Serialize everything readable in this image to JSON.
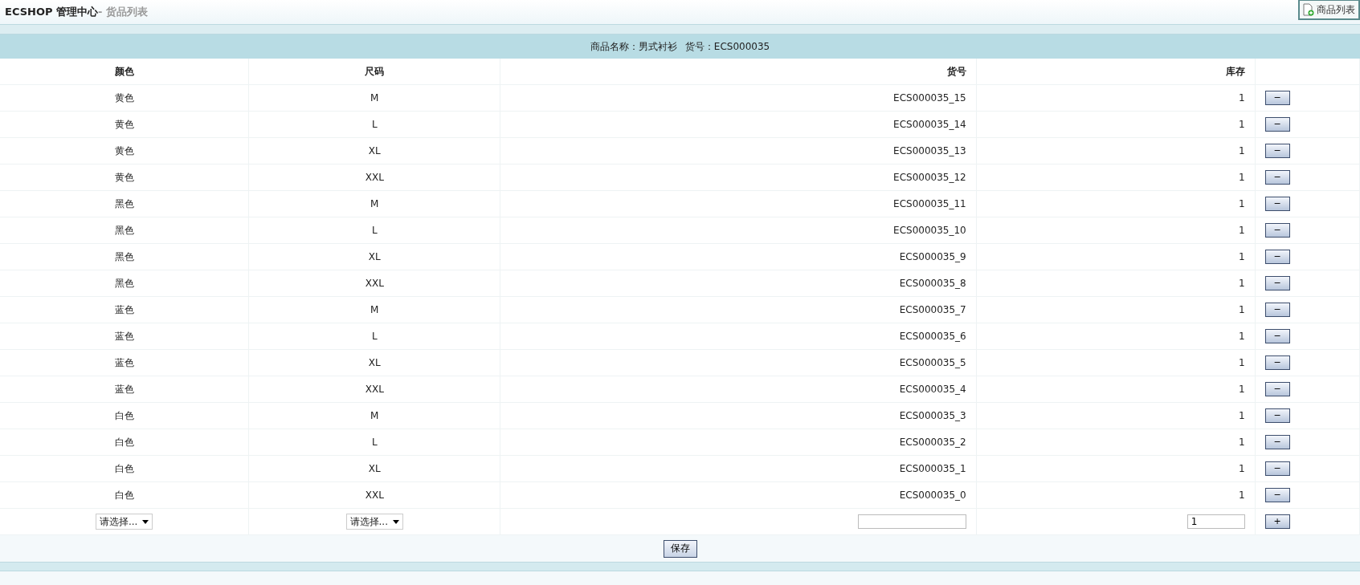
{
  "header": {
    "title": "ECSHOP 管理中心",
    "subtitle": "- 货品列表",
    "action": "商品列表"
  },
  "caption": {
    "name_label": "商品名称：",
    "name": "男式衬衫",
    "sn_label": "货号：",
    "sn": "ECS000035"
  },
  "col_names": [
    "颜色",
    "尺码",
    "货号",
    "库存"
  ],
  "rows": [
    {
      "color_name": "黄色",
      "size": "M",
      "sn": "ECS000035_15",
      "stock": "1",
      "action": "−"
    },
    {
      "color_name": "黄色",
      "size": "L",
      "sn": "ECS000035_14",
      "stock": "1",
      "action": "−"
    },
    {
      "color_name": "黄色",
      "size": "XL",
      "sn": "ECS000035_13",
      "stock": "1",
      "action": "−"
    },
    {
      "color_name": "黄色",
      "size": "XXL",
      "sn": "ECS000035_12",
      "stock": "1",
      "action": "−"
    },
    {
      "color_name": "黑色",
      "size": "M",
      "sn": "ECS000035_11",
      "stock": "1",
      "action": "−"
    },
    {
      "color_name": "黑色",
      "size": "L",
      "sn": "ECS000035_10",
      "stock": "1",
      "action": "−"
    },
    {
      "color_name": "黑色",
      "size": "XL",
      "sn": "ECS000035_9",
      "stock": "1",
      "action": "−"
    },
    {
      "color_name": "黑色",
      "size": "XXL",
      "sn": "ECS000035_8",
      "stock": "1",
      "action": "−"
    },
    {
      "color_name": "蓝色",
      "size": "M",
      "sn": "ECS000035_7",
      "stock": "1",
      "action": "−"
    },
    {
      "color_name": "蓝色",
      "size": "L",
      "sn": "ECS000035_6",
      "stock": "1",
      "action": "−"
    },
    {
      "color_name": "蓝色",
      "size": "XL",
      "sn": "ECS000035_5",
      "stock": "1",
      "action": "−"
    },
    {
      "color_name": "蓝色",
      "size": "XXL",
      "sn": "ECS000035_4",
      "stock": "1",
      "action": "−"
    },
    {
      "color_name": "白色",
      "size": "M",
      "sn": "ECS000035_3",
      "stock": "1",
      "action": "−"
    },
    {
      "color_name": "白色",
      "size": "L",
      "sn": "ECS000035_2",
      "stock": "1",
      "action": "−"
    },
    {
      "color_name": "白色",
      "size": "XL",
      "sn": "ECS000035_1",
      "stock": "1",
      "action": "−"
    },
    {
      "color_name": "白色",
      "size": "XXL",
      "sn": "ECS000035_0",
      "stock": "1",
      "action": "−"
    }
  ],
  "new_row": {
    "color_select": "请选择...",
    "size_select": "请选择...",
    "stock_value": "1",
    "add": "+"
  },
  "save": "保存"
}
